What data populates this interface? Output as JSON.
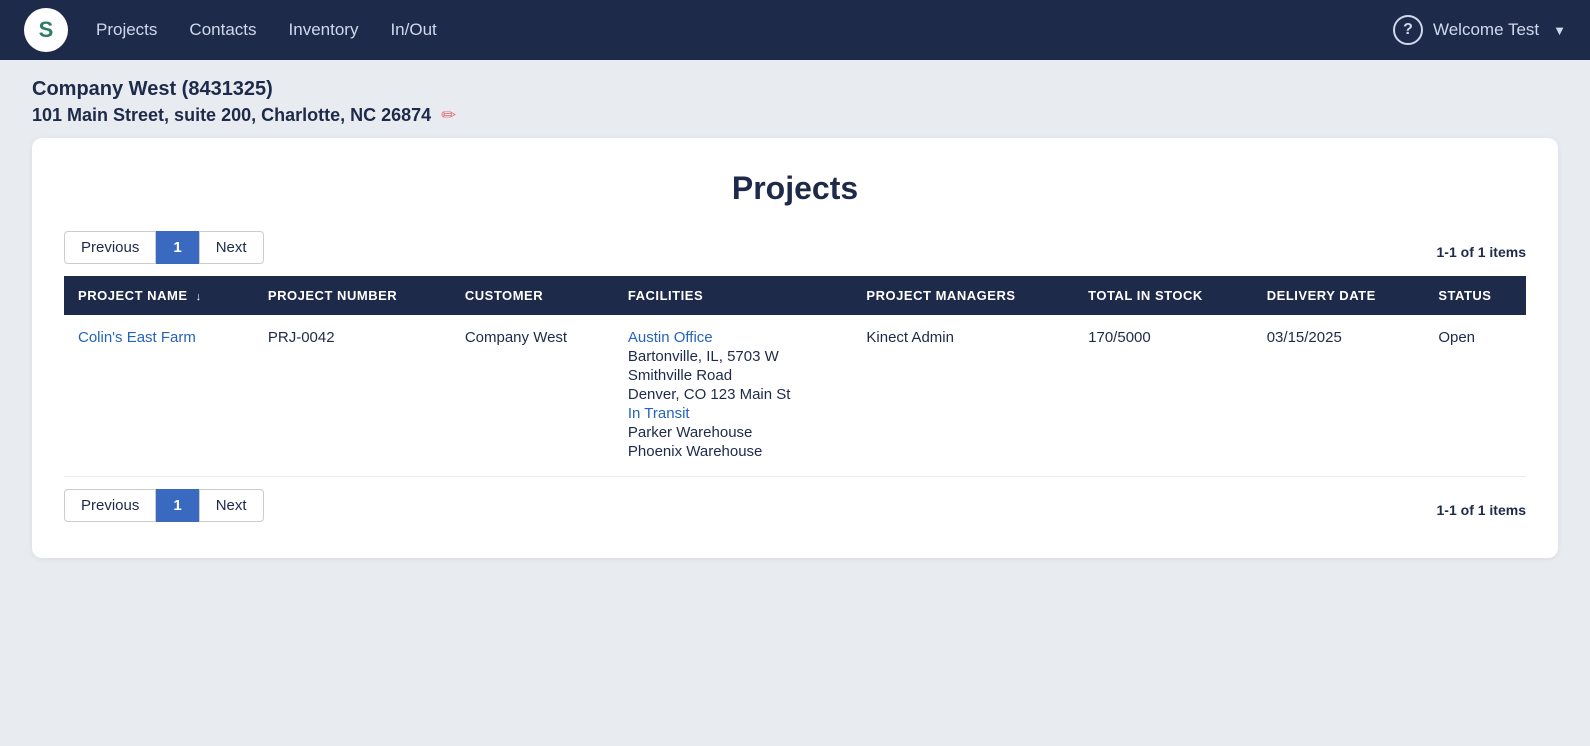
{
  "navbar": {
    "logo_letter": "S",
    "links": [
      {
        "id": "projects",
        "label": "Projects"
      },
      {
        "id": "contacts",
        "label": "Contacts"
      },
      {
        "id": "inventory",
        "label": "Inventory"
      },
      {
        "id": "inout",
        "label": "In/Out"
      }
    ],
    "help_icon": "?",
    "welcome_label": "Welcome Test",
    "dropdown_arrow": "▼"
  },
  "subheader": {
    "company_name": "Company West (8431325)",
    "company_address": "101 Main Street, suite 200, Charlotte, NC 26874",
    "edit_icon": "✏"
  },
  "card": {
    "title": "Projects",
    "pagination_top": {
      "previous_label": "Previous",
      "page_number": "1",
      "next_label": "Next",
      "info": "1-1 of 1 items"
    },
    "pagination_bottom": {
      "previous_label": "Previous",
      "page_number": "1",
      "next_label": "Next",
      "info": "1-1 of 1 items"
    },
    "table": {
      "columns": [
        {
          "id": "project_name",
          "label": "PROJECT NAME",
          "sortable": true,
          "sort_arrow": "↓"
        },
        {
          "id": "project_number",
          "label": "PROJECT NUMBER",
          "sortable": false
        },
        {
          "id": "customer",
          "label": "CUSTOMER",
          "sortable": false
        },
        {
          "id": "facilities",
          "label": "FACILITIES",
          "sortable": false
        },
        {
          "id": "project_managers",
          "label": "PROJECT MANAGERS",
          "sortable": false
        },
        {
          "id": "total_in_stock",
          "label": "TOTAL IN STOCK",
          "sortable": false
        },
        {
          "id": "delivery_date",
          "label": "DELIVERY DATE",
          "sortable": false
        },
        {
          "id": "status",
          "label": "STATUS",
          "sortable": false
        }
      ],
      "rows": [
        {
          "project_name": "Colin's East Farm",
          "project_number": "PRJ-0042",
          "customer": "Company West",
          "facilities": [
            {
              "text": "Austin Office",
              "link": true
            },
            {
              "text": "Bartonville, IL, 5703 W",
              "link": false
            },
            {
              "text": "Smithville Road",
              "link": false
            },
            {
              "text": "Denver, CO 123 Main St",
              "link": false
            },
            {
              "text": "In Transit",
              "link": true
            },
            {
              "text": "Parker Warehouse",
              "link": false
            },
            {
              "text": "Phoenix Warehouse",
              "link": false
            }
          ],
          "project_managers": "Kinect Admin",
          "total_in_stock": "170/5000",
          "delivery_date": "03/15/2025",
          "status": "Open"
        }
      ]
    }
  }
}
